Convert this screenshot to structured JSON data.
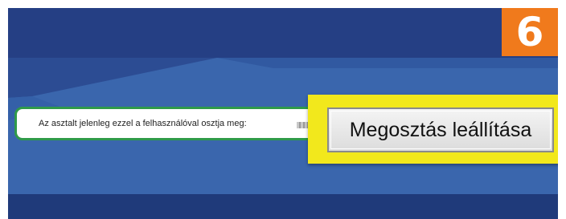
{
  "step_badge": {
    "label": "6",
    "color": "#f07a1c"
  },
  "sharing_bar": {
    "message": "Az asztalt jelenleg ezzel a felhasználóval osztja meg:",
    "username_redacted": true
  },
  "stop_sharing_button": {
    "label": "Megosztás leállítása"
  },
  "colors": {
    "desktop": "#3a66ad",
    "top_band": "#253f84",
    "bar_border": "#2f9a4a",
    "highlight": "#f2e81c"
  }
}
